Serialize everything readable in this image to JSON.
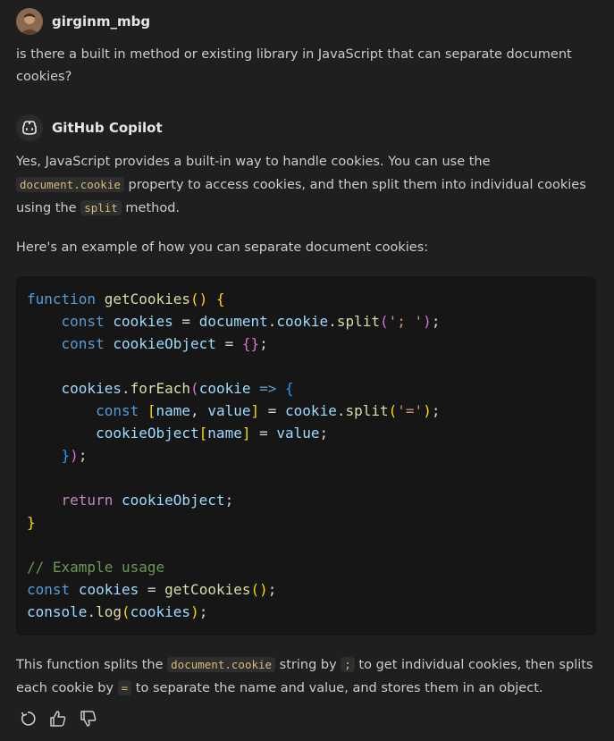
{
  "user": {
    "name": "girginm_mbg",
    "message": "is there a built in method or existing library in JavaScript that can separate document cookies?"
  },
  "assistant": {
    "name": "GitHub Copilot",
    "p1": {
      "t1": "Yes, JavaScript provides a built-in way to handle cookies. You can use the ",
      "c1": "document.cookie",
      "t2": " property to access cookies, and then split them into individual cookies using the ",
      "c2": "split",
      "t3": " method."
    },
    "p2": "Here's an example of how you can separate document cookies:",
    "code": {
      "language": "javascript",
      "lines": [
        "function getCookies() {",
        "    const cookies = document.cookie.split('; ');",
        "    const cookieObject = {};",
        "",
        "    cookies.forEach(cookie => {",
        "        const [name, value] = cookie.split('=');",
        "        cookieObject[name] = value;",
        "    });",
        "",
        "    return cookieObject;",
        "}",
        "",
        "// Example usage",
        "const cookies = getCookies();",
        "console.log(cookies);"
      ]
    },
    "p3": {
      "t1": "This function splits the ",
      "c1": "document.cookie",
      "t2": " string by ",
      "c2": ";",
      "t3": " to get individual cookies, then splits each cookie by ",
      "c3": "=",
      "t4": " to separate the name and value, and stores them in an object."
    }
  },
  "actions": [
    "regenerate-icon",
    "thumbs-up-icon",
    "thumbs-down-icon"
  ]
}
